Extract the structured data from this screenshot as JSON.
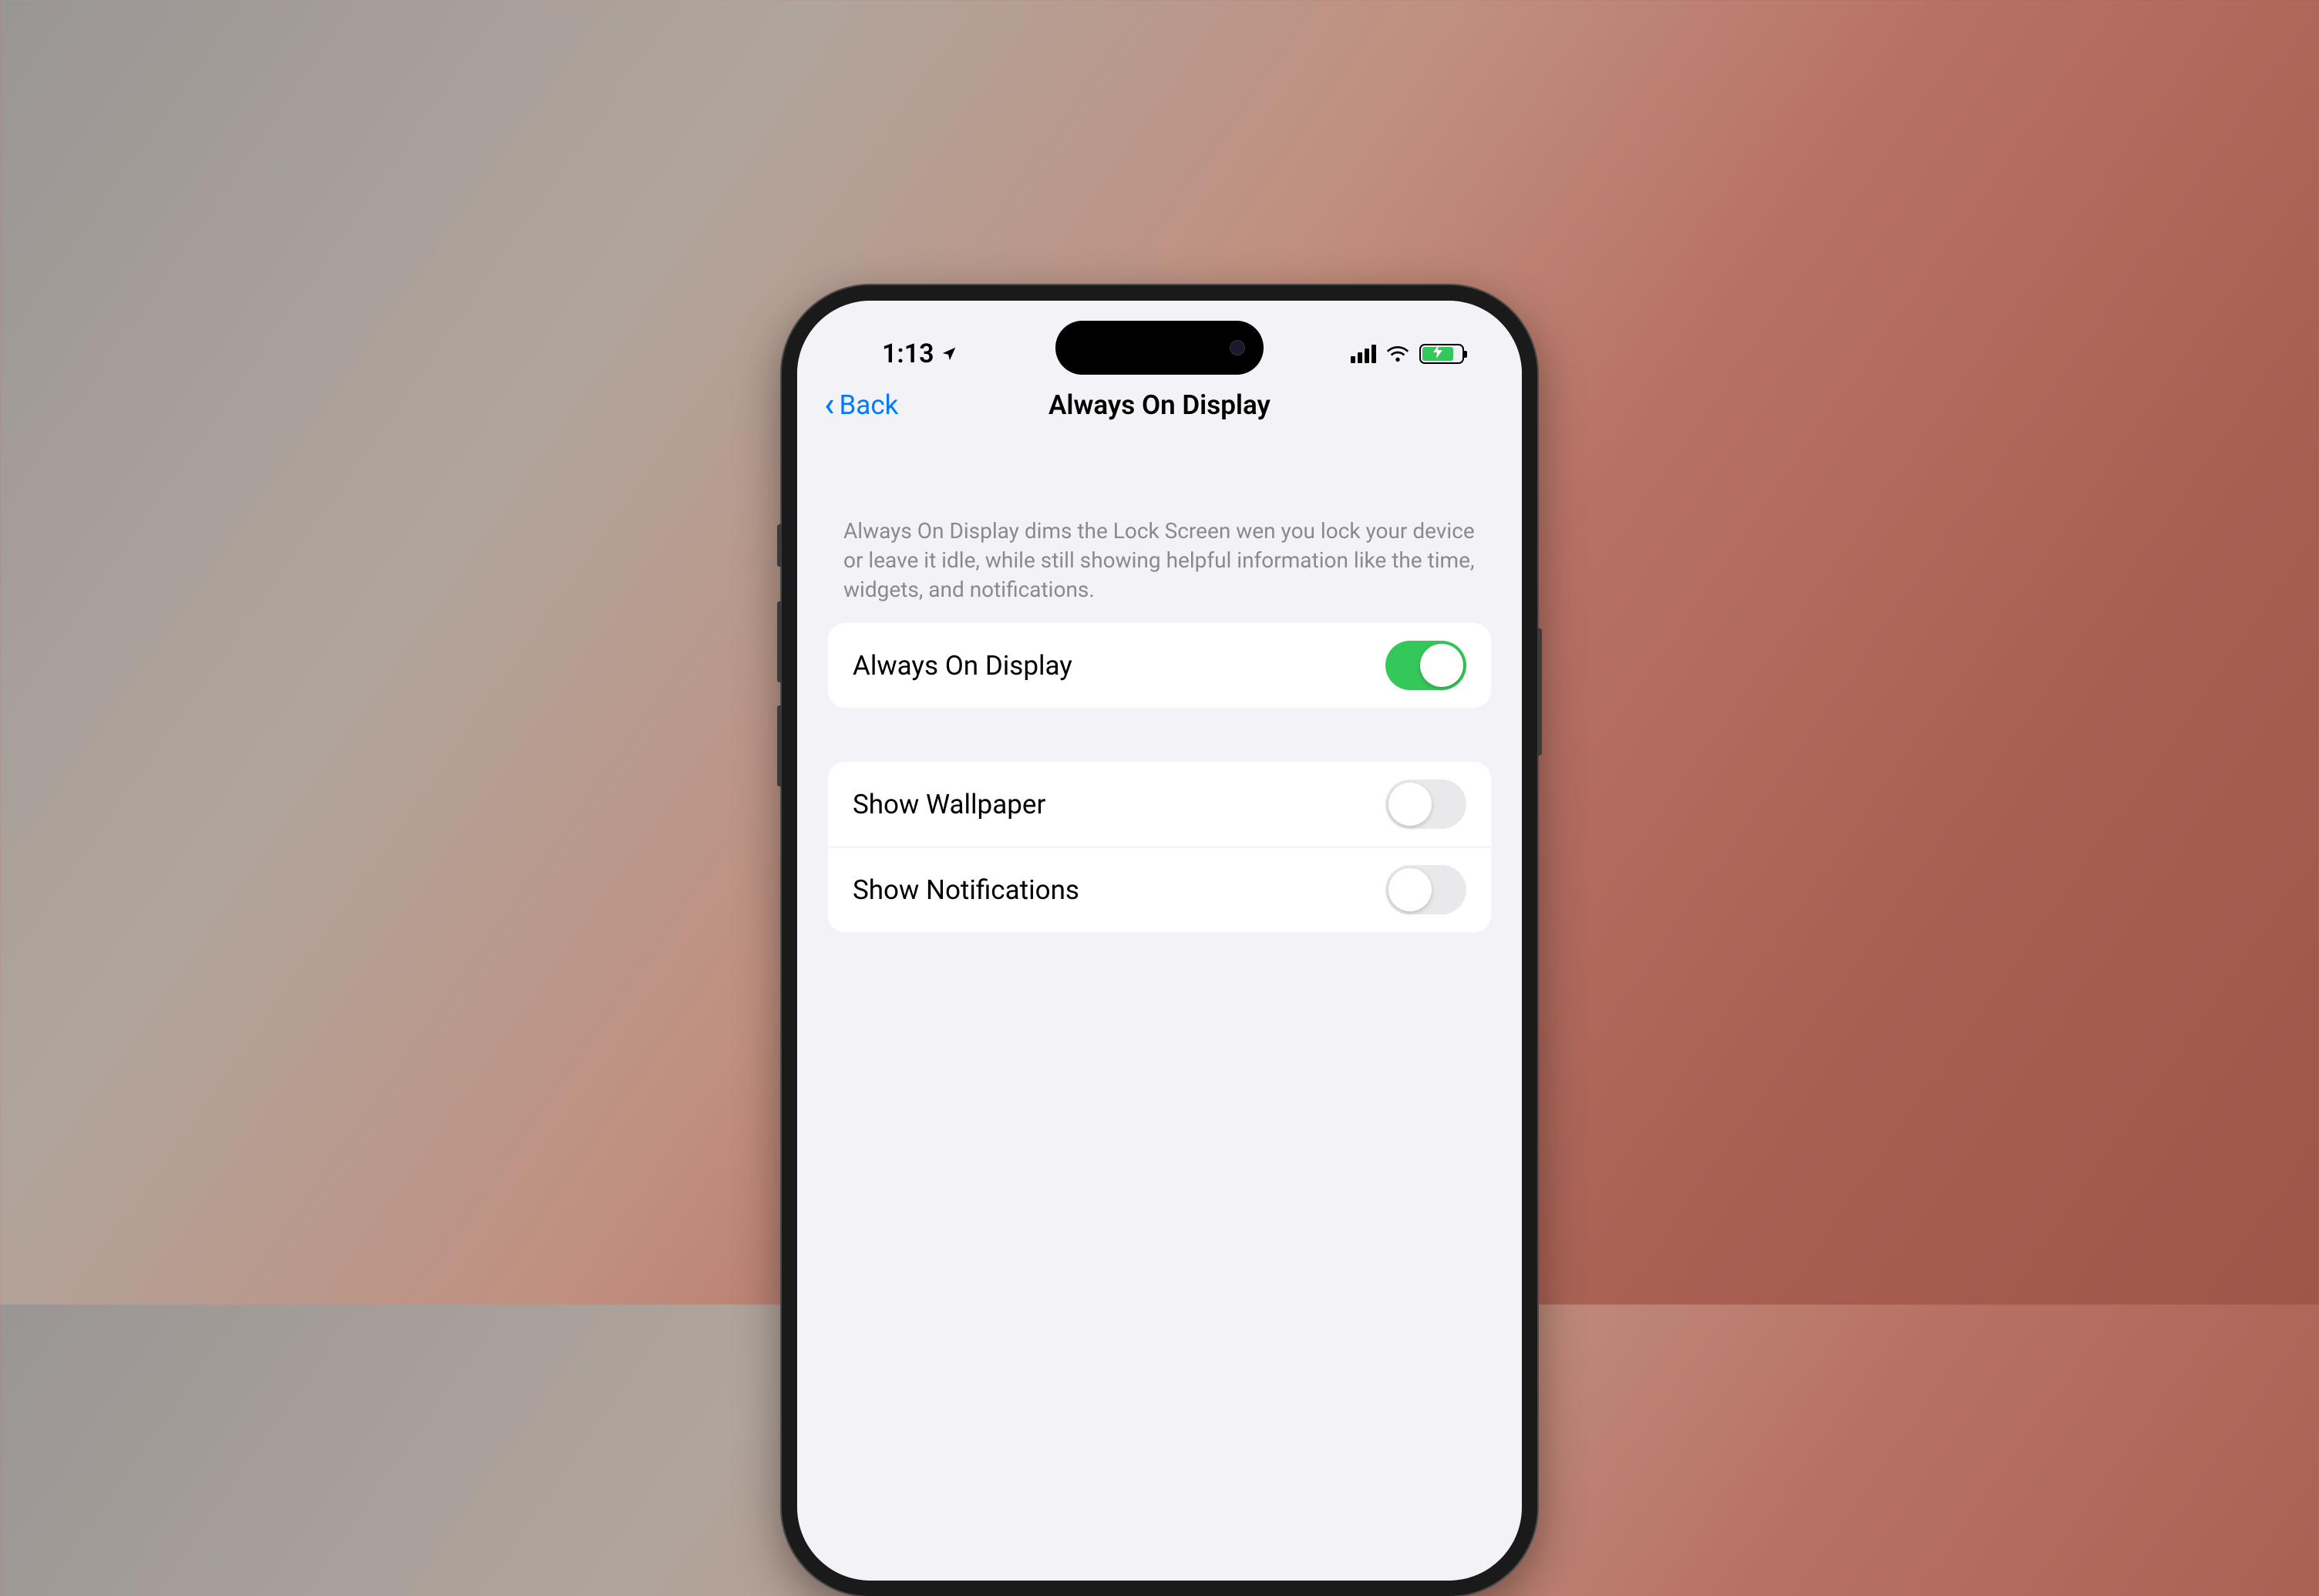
{
  "statusBar": {
    "time": "1:13"
  },
  "navBar": {
    "backLabel": "Back",
    "title": "Always On Display"
  },
  "description": "Always On Display dims the Lock Screen wen you lock your device or leave it idle, while still showing helpful information like the time, widgets, and notifications.",
  "settings": {
    "group1": [
      {
        "label": "Always On Display",
        "enabled": true
      }
    ],
    "group2": [
      {
        "label": "Show Wallpaper",
        "enabled": false
      },
      {
        "label": "Show Notifications",
        "enabled": false
      }
    ]
  }
}
